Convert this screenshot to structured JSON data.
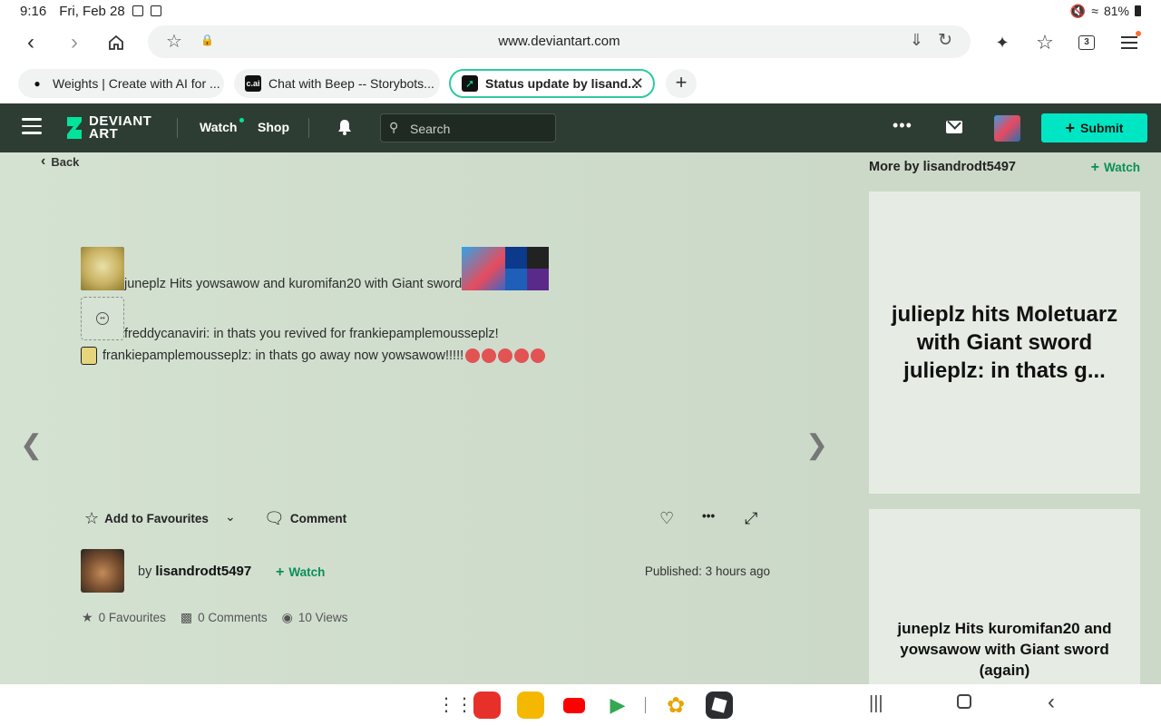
{
  "status_bar": {
    "time": "9:16",
    "date": "Fri, Feb 28",
    "battery": "81%"
  },
  "browser": {
    "url": "www.deviantart.com",
    "tabs_count": "3",
    "tabs": [
      {
        "label": "Weights | Create with AI for ...",
        "favicon": "weights-icon"
      },
      {
        "label": "Chat with Beep -- Storybots...",
        "favicon": "c-ai-icon",
        "favicon_text": "c.ai"
      },
      {
        "label": "Status update by lisand...",
        "favicon": "deviantart-icon",
        "active": true
      }
    ]
  },
  "da_header": {
    "logo_line1": "DEVIANT",
    "logo_line2": "ART",
    "watch": "Watch",
    "shop": "Shop",
    "search_placeholder": "Search",
    "submit": "Submit",
    "more": "•••"
  },
  "deviation": {
    "back": "Back",
    "lines": [
      {
        "text": "juneplz Hits yowsawow and kuromifan20 with Giant sword"
      },
      {
        "text": "freddycanaviri: in thats you revived for frankiepamplemousseplz!"
      },
      {
        "text": "frankiepamplemousseplz: in thats go away now yowsawow!!!!!"
      }
    ],
    "actions": {
      "favourite": "Add to Favourites",
      "comment": "Comment",
      "more": "•••"
    },
    "author": {
      "by": "by",
      "name": "lisandrodt5497",
      "watch": "Watch",
      "published": "Published: 3 hours ago"
    },
    "stats": {
      "favourites": "0 Favourites",
      "comments": "0 Comments",
      "views": "10 Views"
    }
  },
  "sidebar": {
    "title": "More by lisandrodt5497",
    "watch": "Watch",
    "cards": [
      {
        "text": "julieplz hits Moletuarz with Giant sword julieplz: in thats g..."
      },
      {
        "text": "juneplz Hits kuromifan20 and yowsawow with Giant sword (again)"
      }
    ]
  },
  "colors": {
    "da_header": "#2e3d33",
    "submit": "#00e6c4",
    "accent_green": "#0a8f5a",
    "main_bg": "#d0ddcd",
    "active_tab_border": "#2ec9a0"
  }
}
